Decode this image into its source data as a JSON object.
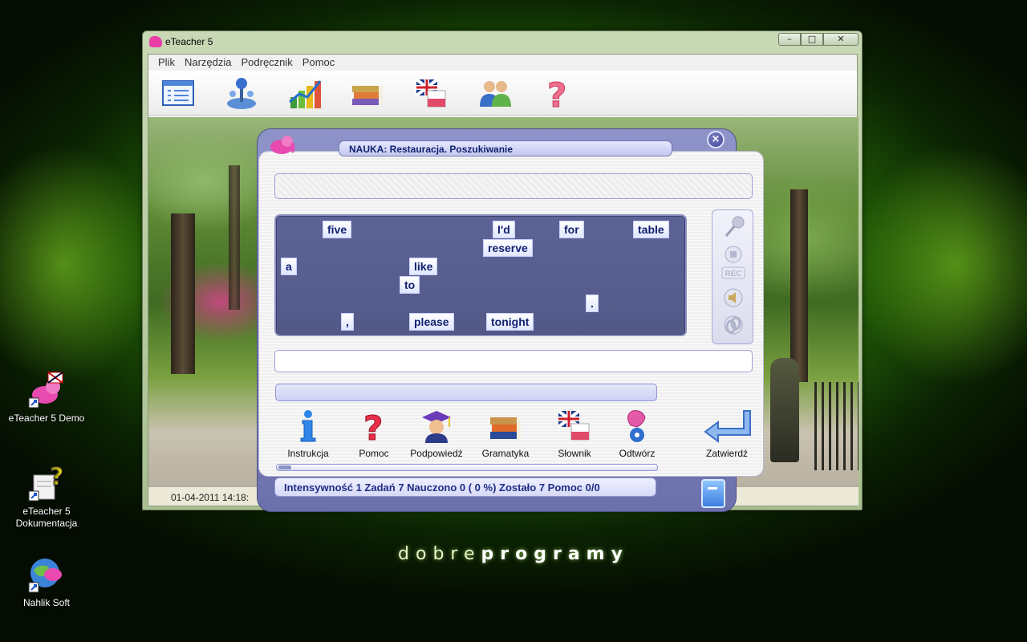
{
  "desktop": {
    "brand_light": "dobre",
    "brand_bold": "programy",
    "icons": [
      {
        "label": "eTeacher 5 Demo",
        "icon": "elephant-flag-icon"
      },
      {
        "label": "eTeacher 5 Dokumentacja",
        "icon": "help-document-icon"
      },
      {
        "label": "Nahlik Soft",
        "icon": "globe-elephant-icon"
      }
    ]
  },
  "window": {
    "title": "eTeacher 5",
    "controls": {
      "minimize": "–",
      "maximize": "□",
      "close": "✕"
    },
    "menu": [
      "Plik",
      "Narzędzia",
      "Podręcznik",
      "Pomoc"
    ],
    "toolbar": [
      "lessons-list-icon",
      "joystick-icon",
      "chart-icon",
      "books-icon",
      "flag-dictionary-icon",
      "users-icon",
      "help-icon"
    ],
    "status_datetime": "01-04-2011 14:18:"
  },
  "dialog": {
    "title": "NAUKA: Restauracja. Poszukiwanie",
    "close_label": "×",
    "words": [
      {
        "text": "five"
      },
      {
        "text": "I'd"
      },
      {
        "text": "for"
      },
      {
        "text": "table"
      },
      {
        "text": "reserve"
      },
      {
        "text": "a"
      },
      {
        "text": "like"
      },
      {
        "text": "to"
      },
      {
        "text": "."
      },
      {
        "text": ","
      },
      {
        "text": "please"
      },
      {
        "text": "tonight"
      }
    ],
    "side_controls": [
      "microphone-icon",
      "stop-icon",
      "rec-icon",
      "speaker-icon",
      "link-icon"
    ],
    "rec_label": "REC",
    "actions": [
      {
        "label": "Instrukcja",
        "icon": "info-icon"
      },
      {
        "label": "Pomoc",
        "icon": "help-icon"
      },
      {
        "label": "Podpowiedź",
        "icon": "graduate-icon"
      },
      {
        "label": "Gramatyka",
        "icon": "books-icon"
      },
      {
        "label": "Słownik",
        "icon": "flag-dictionary-icon"
      },
      {
        "label": "Odtwórz",
        "icon": "gramophone-icon"
      }
    ],
    "confirm_label": "Zatwierdź",
    "status": "Intensywność 1 Zadań 7 Nauczono 0 ( 0 %) Zostało 7 Pomoc 0/0",
    "progress": 0.0
  },
  "colors": {
    "accent": "#6c71ac",
    "tile_text": "#112070",
    "board": "#5a6092"
  }
}
